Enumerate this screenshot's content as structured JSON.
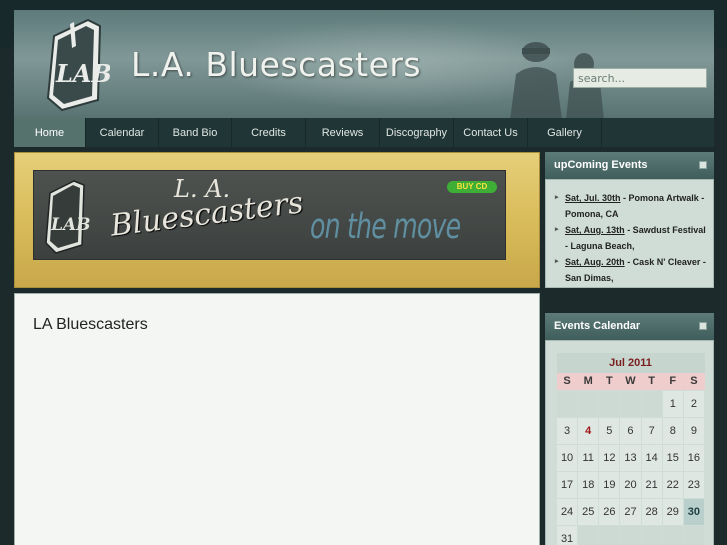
{
  "site": {
    "title": "L.A. Bluescasters",
    "logo_text": "LAB"
  },
  "search": {
    "placeholder": "search..."
  },
  "nav": {
    "items": [
      {
        "label": "Home",
        "active": true
      },
      {
        "label": "Calendar",
        "active": false
      },
      {
        "label": "Band Bio",
        "active": false
      },
      {
        "label": "Credits",
        "active": false
      },
      {
        "label": "Reviews",
        "active": false
      },
      {
        "label": "Discography",
        "active": false
      },
      {
        "label": "Contact Us",
        "active": false
      },
      {
        "label": "Gallery",
        "active": false
      }
    ]
  },
  "banner": {
    "la": "L. A.",
    "name": "Bluescasters",
    "tagline": "on the move",
    "buy_cd": "BUY CD"
  },
  "content": {
    "title": "LA Bluescasters"
  },
  "events": {
    "header": "upComing Events",
    "items": [
      {
        "date": "Sat, Jul. 30th",
        "text": " - Pomona Artwalk - Pomona, CA"
      },
      {
        "date": "Sat, Aug. 13th",
        "text": " - Sawdust Festival - Laguna Beach,"
      },
      {
        "date": "Sat, Aug. 20th",
        "text": " - Cask N' Cleaver - San Dimas,"
      }
    ]
  },
  "calendar": {
    "header": "Events Calendar",
    "month": "Jul 2011",
    "days_of_week": [
      "S",
      "M",
      "T",
      "W",
      "T",
      "F",
      "S"
    ],
    "weeks": [
      [
        "",
        "",
        "",
        "",
        "",
        "1",
        "2"
      ],
      [
        "3",
        "4",
        "5",
        "6",
        "7",
        "8",
        "9"
      ],
      [
        "10",
        "11",
        "12",
        "13",
        "14",
        "15",
        "16"
      ],
      [
        "17",
        "18",
        "19",
        "20",
        "21",
        "22",
        "23"
      ],
      [
        "24",
        "25",
        "26",
        "27",
        "28",
        "29",
        "30"
      ],
      [
        "31",
        "",
        "",
        "",
        "",
        "",
        ""
      ]
    ],
    "today": "4",
    "selected": "30"
  },
  "colors": {
    "nav_bg": "#203535",
    "nav_active": "#56726d",
    "promo_gold": "#d9bc5a",
    "today_red": "#a01515"
  }
}
